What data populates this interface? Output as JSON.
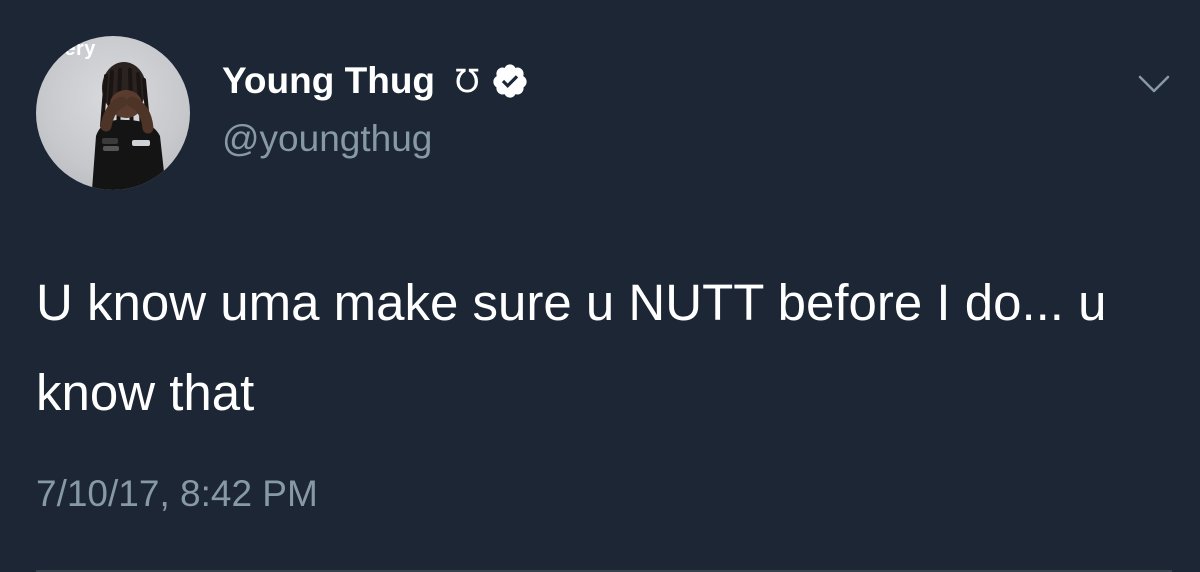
{
  "tweet": {
    "avatar": {
      "label": "ffery"
    },
    "author": {
      "display_name": "Young Thug",
      "name_glyph": "Ʊ",
      "verified": true,
      "handle": "@youngthug"
    },
    "text": "U know uma make sure u NUTT before I do... u know that",
    "timestamp": "7/10/17, 8:42 PM"
  },
  "icons": {
    "verified": "verified-badge-icon",
    "menu": "chevron-down-icon"
  },
  "colors": {
    "background": "#1c2634",
    "primary_text": "#ffffff",
    "secondary_text": "#8899a6"
  }
}
